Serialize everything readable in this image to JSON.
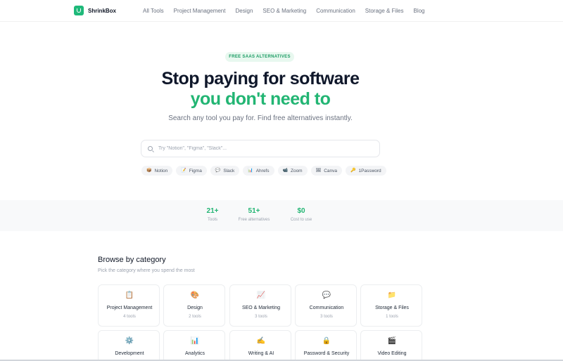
{
  "nav": {
    "brand": "ShrinkBox",
    "links": [
      "All Tools",
      "Project Management",
      "Design",
      "SEO & Marketing",
      "Communication",
      "Storage & Files",
      "Blog"
    ]
  },
  "hero": {
    "badge": "FREE SAAS ALTERNATIVES",
    "headline_line1": "Stop paying for software",
    "headline_line2": "you don't need to",
    "subtitle": "Search any tool you pay for. Find free alternatives instantly."
  },
  "search": {
    "placeholder": "Try \"Notion\", \"Figma\", \"Slack\"..."
  },
  "chips": [
    {
      "icon": "📦",
      "label": "Notion"
    },
    {
      "icon": "📝",
      "label": "Figma"
    },
    {
      "icon": "💬",
      "label": "Slack"
    },
    {
      "icon": "📊",
      "label": "Ahrefs"
    },
    {
      "icon": "📹",
      "label": "Zoom"
    },
    {
      "icon": "🖼",
      "label": "Canva"
    },
    {
      "icon": "🔑",
      "label": "1Password"
    }
  ],
  "stats": [
    {
      "value": "21+",
      "label": "Tools"
    },
    {
      "value": "51+",
      "label": "Free alternatives"
    },
    {
      "value": "$0",
      "label": "Cost to use"
    }
  ],
  "categories": {
    "title": "Browse by category",
    "subtitle": "Pick the category where you spend the most",
    "items": [
      {
        "icon": "📋",
        "name": "Project Management",
        "count": "4 tools"
      },
      {
        "icon": "🎨",
        "name": "Design",
        "count": "2 tools"
      },
      {
        "icon": "📈",
        "name": "SEO & Marketing",
        "count": "3 tools"
      },
      {
        "icon": "💬",
        "name": "Communication",
        "count": "3 tools"
      },
      {
        "icon": "📁",
        "name": "Storage & Files",
        "count": "1 tools"
      },
      {
        "icon": "⚙️",
        "name": "Development",
        "count": ""
      },
      {
        "icon": "📊",
        "name": "Analytics",
        "count": ""
      },
      {
        "icon": "✍️",
        "name": "Writing & AI",
        "count": ""
      },
      {
        "icon": "🔒",
        "name": "Password & Security",
        "count": ""
      },
      {
        "icon": "🎬",
        "name": "Video Editing",
        "count": ""
      }
    ]
  }
}
